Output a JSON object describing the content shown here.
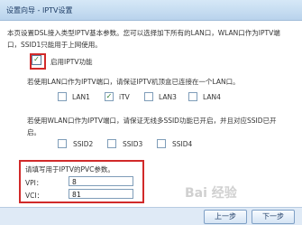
{
  "window": {
    "title": "设置向导 - IPTV设置"
  },
  "description": "本页设置DSL接入类型IPTV基本参数。您可以选择加下所有的LAN口，WLAN口作为IPTV端口，SSID1只能用于上网使用。",
  "enable": {
    "label": "启用IPTV功能",
    "checked": true
  },
  "lan": {
    "text": "若使用LAN口作为IPTV端口，请保证IPTV机顶盒已连接在一个LAN口。",
    "ports": [
      {
        "label": "LAN1",
        "checked": false
      },
      {
        "label": "iTV",
        "checked": true
      },
      {
        "label": "LAN3",
        "checked": false
      },
      {
        "label": "LAN4",
        "checked": false
      }
    ]
  },
  "wlan": {
    "text": "若使用WLAN口作为IPTV端口，请保证无线多SSID功能已开启，并且对应SSID已开启。",
    "ssids": [
      {
        "label": "SSID2",
        "checked": false
      },
      {
        "label": "SSID3",
        "checked": false
      },
      {
        "label": "SSID4",
        "checked": false
      }
    ]
  },
  "pvc": {
    "heading": "请填写用于IPTV的PVC参数。",
    "vpi_label": "VPI：",
    "vpi_value": "8",
    "vci_label": "VCI：",
    "vci_value": "81"
  },
  "buttons": {
    "prev": "上一步",
    "next": "下一步"
  },
  "watermark": "Bai 经验"
}
